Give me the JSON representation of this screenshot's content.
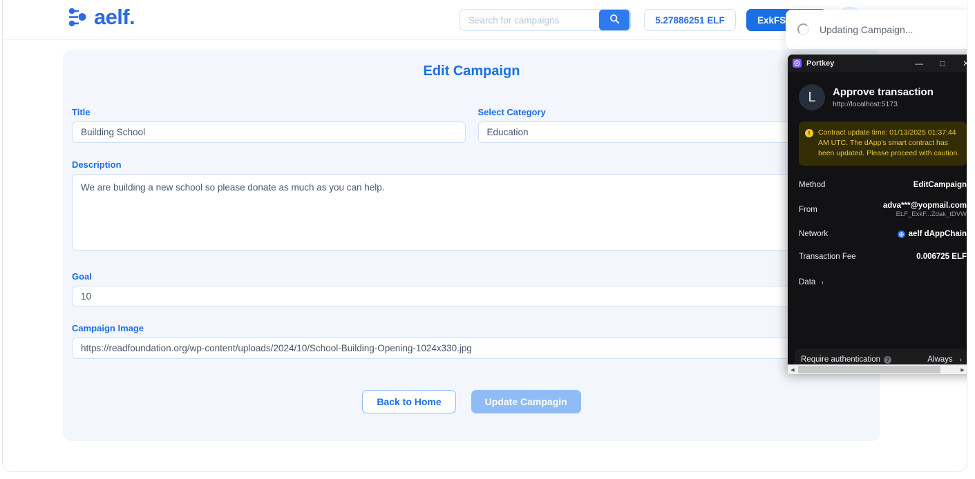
{
  "colors": {
    "brand_blue": "#2d6ae0",
    "accent_blue": "#1b6fe4",
    "card_bg": "#f3f6fc",
    "warn_yellow": "#e9c73c",
    "portkey_bg": "#121214"
  },
  "header": {
    "brand_word": "aelf.",
    "brand_logo_name": "aelf-logo",
    "search": {
      "placeholder": "Search for campaigns",
      "value": "",
      "button_icon": "search-icon"
    },
    "balance": "5.27886251 ELF",
    "wallet_label": "ExkFS.",
    "avatar_icon": "user-avatar-icon"
  },
  "toast": {
    "message": "Updating Campaign...",
    "spinner_icon": "loading-spinner-icon"
  },
  "form": {
    "title": "Edit Campaign",
    "fields": {
      "title": {
        "label": "Title",
        "value": "Building School"
      },
      "category": {
        "label": "Select Category",
        "value": "Education"
      },
      "description": {
        "label": "Description",
        "value": "We are building a new school so please donate as much as you can help."
      },
      "goal": {
        "label": "Goal",
        "value": "10"
      },
      "image": {
        "label": "Campaign Image",
        "value": "https://readfoundation.org/wp-content/uploads/2024/10/School-Building-Opening-1024x330.jpg"
      }
    },
    "buttons": {
      "back": "Back to Home",
      "update": "Update Campagin"
    }
  },
  "portkey": {
    "window_name": "Portkey",
    "window_controls": {
      "minimize": "—",
      "maximize": "□",
      "close": "✕"
    },
    "avatar_letter": "L",
    "title": "Approve transaction",
    "url": "http://localhost:5173",
    "warning": {
      "icon": "warning-exclamation-icon",
      "text": "Contract update time: 01/13/2025 01:37:44 AM UTC. The dApp's smart contract has been updated. Please proceed with caution."
    },
    "rows": [
      {
        "key": "Method",
        "value": "EditCampaign",
        "sub": ""
      },
      {
        "key": "From",
        "value": "adva***@yopmail.com",
        "sub": "ELF_ExkF...Zdak_tDVW"
      },
      {
        "key": "Network",
        "value": "aelf dAppChain",
        "sub": "",
        "icon": "aelf-chain-icon"
      },
      {
        "key": "Transaction Fee",
        "value": "0.006725 ELF",
        "sub": ""
      },
      {
        "key": "Data",
        "value": "",
        "sub": "",
        "chevron": "›"
      }
    ],
    "auth_row": {
      "label": "Require authentication",
      "help_icon": "help-question-icon",
      "value": "Always",
      "chevron": "›"
    },
    "scroll": {
      "up_arrow": "▲",
      "down_arrow": "▼",
      "left_arrow": "◀",
      "right_arrow": "▶"
    }
  }
}
